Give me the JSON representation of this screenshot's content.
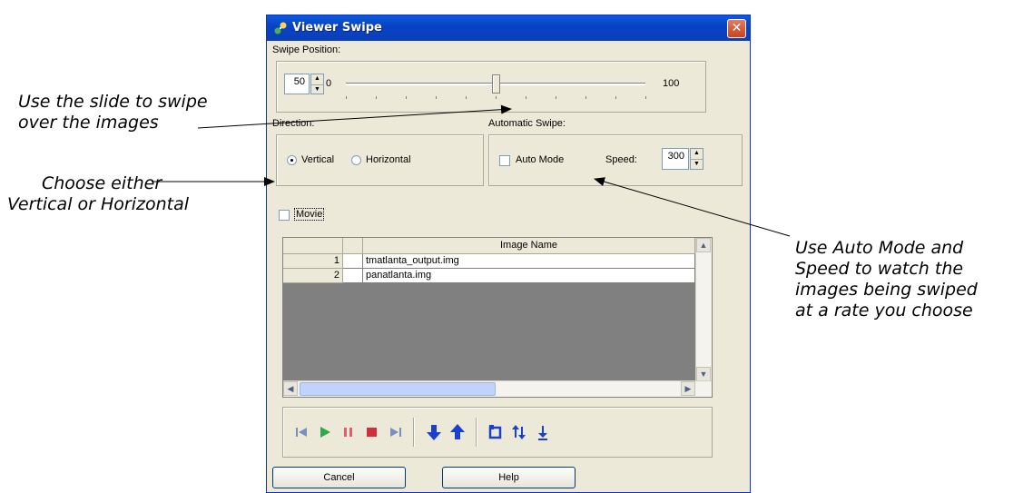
{
  "annotations": {
    "slide": [
      "Use the slide to swipe",
      "over the images"
    ],
    "direction": [
      "Choose either",
      "Vertical or Horizontal"
    ],
    "auto": [
      "Use Auto Mode and",
      "Speed to watch the",
      "images being swiped",
      "at a rate you choose"
    ]
  },
  "window": {
    "title": "Viewer Swipe",
    "close_label": "✕"
  },
  "swipe": {
    "label": "Swipe Position:",
    "value": "50",
    "min_label": "0",
    "max_label": "100",
    "position_percent": 50
  },
  "direction": {
    "label": "Direction:",
    "options": [
      "Vertical",
      "Horizontal"
    ],
    "selected": "Vertical"
  },
  "automatic": {
    "label": "Automatic Swipe:",
    "auto_mode_label": "Auto Mode",
    "auto_mode_checked": false,
    "speed_label": "Speed:",
    "speed_value": "300"
  },
  "movie": {
    "label": "Movie",
    "checked": false
  },
  "table": {
    "header": "Image Name",
    "rows": [
      {
        "num": "1",
        "name": "tmatlanta_output.img"
      },
      {
        "num": "2",
        "name": "panatlanta.img"
      }
    ]
  },
  "toolbar": {
    "icons": [
      "first-frame-icon",
      "play-icon",
      "pause-icon",
      "stop-icon",
      "last-frame-icon",
      "move-down-icon",
      "move-up-icon",
      "refresh-icon",
      "sort-icon",
      "move-bottom-icon"
    ]
  },
  "buttons": {
    "cancel": "Cancel",
    "help": "Help"
  },
  "colors": {
    "title_bar": "#0a5bd8",
    "dialog_bg": "#ece9d8",
    "icon_blue": "#1b3fd1",
    "icon_green": "#2fa84a",
    "icon_red": "#d0303b",
    "icon_grey": "#7b8ec0"
  }
}
